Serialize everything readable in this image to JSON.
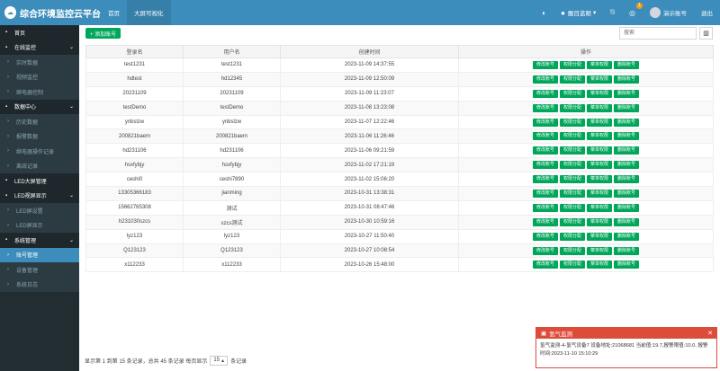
{
  "header": {
    "title": "综合环境监控云平台",
    "nav": [
      {
        "label": "首页",
        "active": false
      },
      {
        "label": "大屏可视化",
        "active": true
      }
    ],
    "theme_label": "醒目蓝眼",
    "notification_count": "1",
    "user_label": "演示账号",
    "logout_label": "退出"
  },
  "sidebar": {
    "rows": [
      {
        "type": "section",
        "label": "首页",
        "icon": "home-icon"
      },
      {
        "type": "section",
        "label": "在线监控",
        "icon": "monitor-icon",
        "chevron": "⌄"
      },
      {
        "type": "sub",
        "label": "实时数据"
      },
      {
        "type": "sub",
        "label": "视频监控"
      },
      {
        "type": "sub",
        "label": "继电器控制"
      },
      {
        "type": "section",
        "label": "数据中心",
        "icon": "database-icon",
        "chevron": "⌄"
      },
      {
        "type": "sub",
        "label": "历史数据"
      },
      {
        "type": "sub",
        "label": "报警数据"
      },
      {
        "type": "sub",
        "label": "继电器操作记录"
      },
      {
        "type": "sub",
        "label": "离线记录"
      },
      {
        "type": "section",
        "label": "LED大屏管理",
        "icon": "screen-icon"
      },
      {
        "type": "section",
        "label": "LED视屏显示",
        "icon": "display-icon",
        "chevron": "⌄"
      },
      {
        "type": "sub",
        "label": "LED屏设置"
      },
      {
        "type": "sub",
        "label": "LED屏显示"
      },
      {
        "type": "section",
        "label": "系统管理",
        "icon": "gear-icon",
        "chevron": "⌄"
      },
      {
        "type": "sub",
        "label": "账号管理",
        "active": true
      },
      {
        "type": "sub",
        "label": "设备管理"
      },
      {
        "type": "sub",
        "label": "系统日志"
      }
    ]
  },
  "toolbar": {
    "add_label": "+ 添加账号",
    "search_placeholder": "搜索"
  },
  "table": {
    "headers": [
      "登录名",
      "用户名",
      "创建时间",
      "操作"
    ],
    "actions": [
      "修改账号",
      "权限分配",
      "菜单权限",
      "删除账号"
    ],
    "rows": [
      [
        "test1231",
        "test1231",
        "2023-11-09 14:37:55"
      ],
      [
        "hdtest",
        "hd12345",
        "2023-11-09 12:50:09"
      ],
      [
        "20231109",
        "20231109",
        "2023-11-09 11:23:07"
      ],
      [
        "testDemo",
        "testDemo",
        "2023-11-08 13:23:08"
      ],
      [
        "ynbslzw",
        "ynbslzw",
        "2023-11-07 12:22:46"
      ],
      [
        "200821baem",
        "200821baem",
        "2023-11-06 11:26:46"
      ],
      [
        "hd231106",
        "hd231106",
        "2023-11-06 09:21:59"
      ],
      [
        "hsxfybjy",
        "hsxfybjy",
        "2023-11-02 17:21:19"
      ],
      [
        "ceshi0",
        "ceshi7890",
        "2023-11-02 15:06:20"
      ],
      [
        "13305366183",
        "jianming",
        "2023-10-31 13:38:31"
      ],
      [
        "15662765308",
        "测试",
        "2023-10-31 08:47:46"
      ],
      [
        "h231030szcs",
        "szcs测试",
        "2023-10-30 10:59:16"
      ],
      [
        "lyz123",
        "lyz123",
        "2023-10-27 11:50:40"
      ],
      [
        "Q123123",
        "Q123123",
        "2023-10-27 10:08:54"
      ],
      [
        "x112233",
        "x112233",
        "2023-10-26 15:48:00"
      ]
    ]
  },
  "footer": {
    "text_before": "显示第 1 到第 15 条记录，总共 45 条记录  每页显示",
    "page_size": "15",
    "text_after": "条记录"
  },
  "alert": {
    "title": "氢气监测",
    "body": "氢气监测-4-氢气设备7 设备地址:21068681 当前值:19.7,报警限值:10.0, 报警时间:2023-11-10 15:10:29"
  }
}
